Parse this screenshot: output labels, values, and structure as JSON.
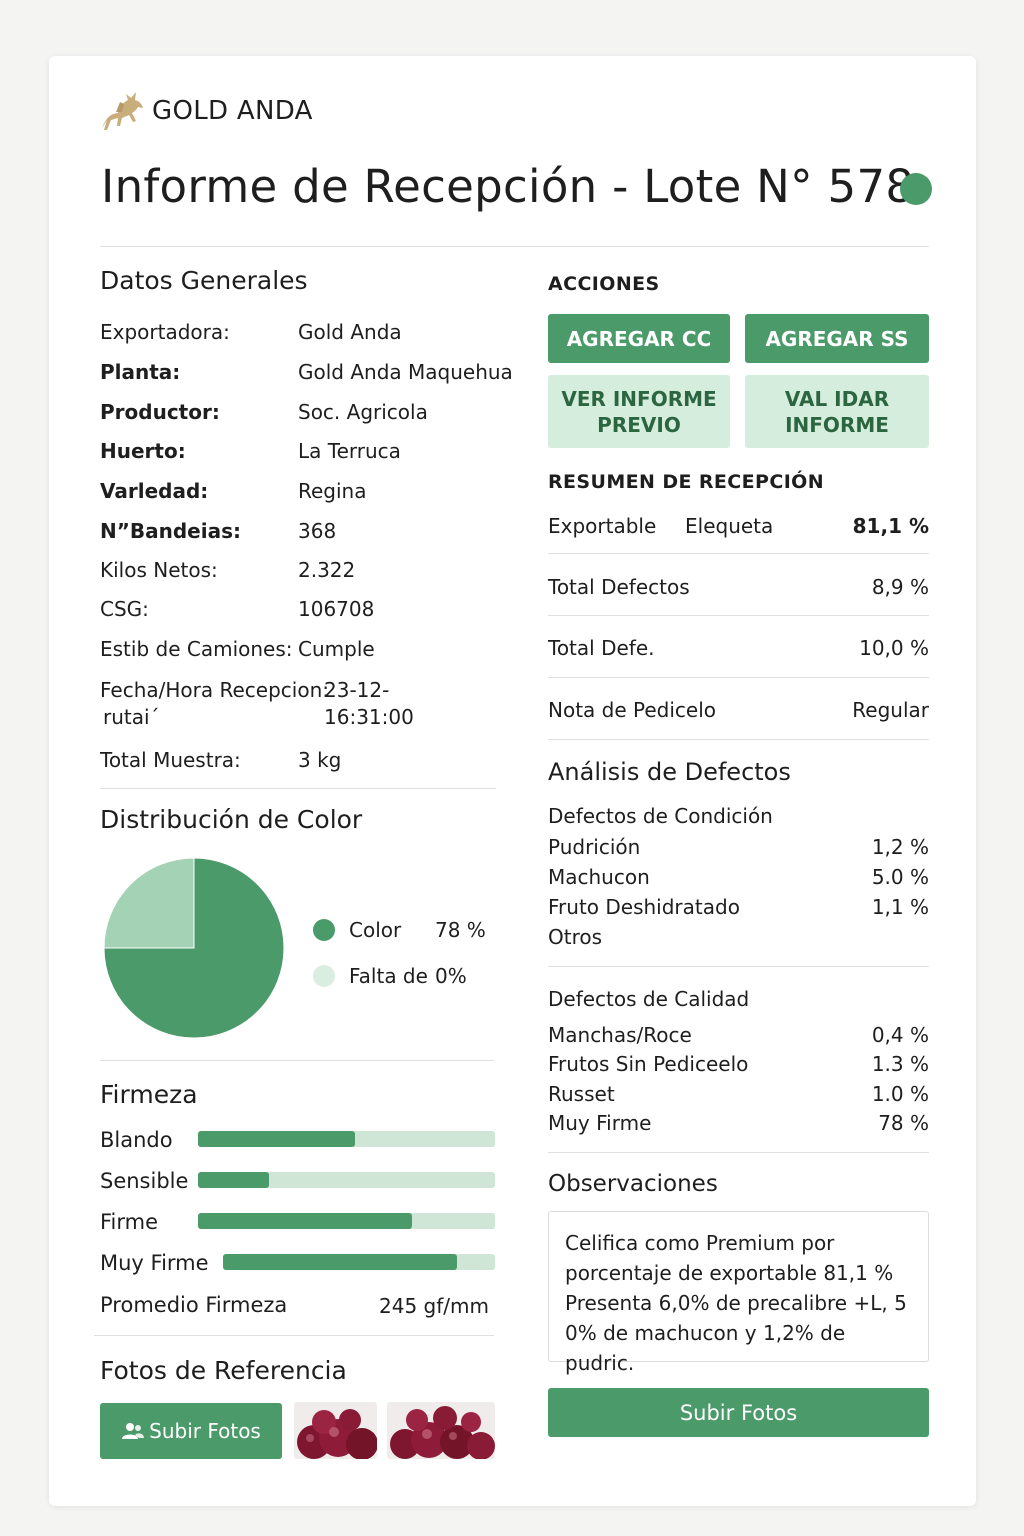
{
  "brand": {
    "name": "GOLD ANDA"
  },
  "title": "Informe de Recepción - Lote N°  578",
  "colors": {
    "accent": "#4a9a6a",
    "accent_light": "#d5eddc",
    "pie_light": "#a3d2b4"
  },
  "datos": {
    "heading": "Datos Generales",
    "fields": [
      {
        "label": "Exportadora:",
        "value": "Gold Anda"
      },
      {
        "label": "Planta:",
        "value": "Gold Anda Maquehua"
      },
      {
        "label": "Productor:",
        "value": "Soc. Agricola"
      },
      {
        "label": "Huerto:",
        "value": "La Terruca"
      },
      {
        "label": "Varledad:",
        "value": "Regina"
      },
      {
        "label": "N”Bandeias:",
        "value": "368"
      },
      {
        "label": "Kilos Netos:",
        "value": "2.322"
      },
      {
        "label": "CSG:",
        "value": "106708"
      },
      {
        "label": "Estib de Camiones:",
        "value": "Cumple"
      },
      {
        "label": "Fecha/Hora Recepcion:",
        "label2": "rutai´",
        "value": "23-12-",
        "value2": "16:31:00"
      },
      {
        "label": "Total Muestra:",
        "value": "3 kg"
      }
    ]
  },
  "color_dist": {
    "heading": "Distribución de Color",
    "legend": [
      {
        "label": "Color",
        "value": "78 %"
      },
      {
        "label": "Falta de ı",
        "value": "0%"
      }
    ]
  },
  "chart_data": {
    "type": "pie",
    "categories": [
      "Color",
      "Falta de ı"
    ],
    "values": [
      75,
      25
    ]
  },
  "firmeza": {
    "heading": "Firmeza",
    "bars": [
      {
        "label": "Blando",
        "fraction": 0.53
      },
      {
        "label": "Sensible",
        "fraction": 0.24
      },
      {
        "label": "Firme",
        "fraction": 0.72
      },
      {
        "label": "Muy Firme",
        "fraction": 0.86
      }
    ],
    "avg_label": "Promedio Firmeza",
    "avg_value": "245 gf/mm"
  },
  "fotos": {
    "heading": "Fotos de Referencia",
    "upload_label": "Subir Fotos"
  },
  "acciones": {
    "heading": "ACCIONES",
    "agregar_cc": "AGREGAR CC",
    "agregar_ss": "AGREGAR SS",
    "ver_line1": "VER INFORME",
    "ver_line2": "PREVIO",
    "validar_line1": "VAL IDAR",
    "validar_line2": "INFORME"
  },
  "resumen": {
    "heading": "RESUMEN DE RECEPCIÓN",
    "rows": [
      {
        "label": "Exportable",
        "mid": "Elequeta",
        "value": "81,1 %"
      },
      {
        "label": "Total Defectos",
        "value": "8,9 %"
      },
      {
        "label": "Total Defe.",
        "value": "10,0 %"
      },
      {
        "label": "Nota de Pedicelo",
        "value": "Regular"
      }
    ]
  },
  "analisis": {
    "heading": "Análisis de Defectos",
    "condicion_heading": "Defectos de Condición",
    "condicion": [
      {
        "label": "Pudrición",
        "value": "1,2 %"
      },
      {
        "label": "Machucon",
        "value": "5.0 %"
      },
      {
        "label": "Fruto Deshidratado",
        "value": "1,1 %"
      },
      {
        "label": "Otros",
        "value": ""
      }
    ],
    "calidad_heading": "Defectos de Calidad",
    "calidad": [
      {
        "label": "Manchas/Roce",
        "value": "0,4 %"
      },
      {
        "label": "Frutos Sin Pediceelo",
        "value": "1.3 %"
      },
      {
        "label": "Russet",
        "value": "1.0 %"
      },
      {
        "label": "Muy Firme",
        "value": "78 %"
      }
    ]
  },
  "observaciones": {
    "heading": "Observaciones",
    "lines": [
      "Celifica como Premium por",
      "porcentaje de exportable 81,1 %",
      "Presenta 6,0% de precalibre +L, 5",
      "0% de machucon y 1,2% de pudric."
    ],
    "upload_label": "Subir Fotos"
  }
}
